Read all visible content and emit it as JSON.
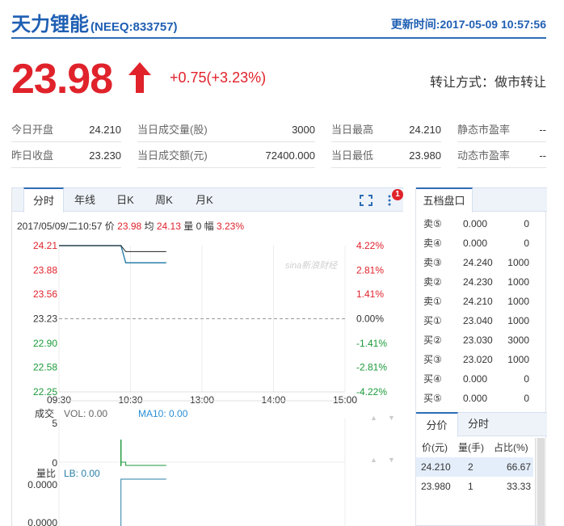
{
  "header": {
    "name": "天力锂能",
    "code": "(NEEQ:833757)",
    "update_time": "更新时间:2017-05-09 10:57:56"
  },
  "quote": {
    "price": "23.98",
    "change": "+0.75(+3.23%)",
    "transfer_mode": "转让方式：做市转让",
    "color_up": "#e0222b"
  },
  "stats": [
    [
      [
        "今日开盘",
        "24.210"
      ],
      [
        "当日成交量(股)",
        "3000"
      ],
      [
        "当日最高",
        "24.210"
      ],
      [
        "静态市盈率",
        "--"
      ]
    ],
    [
      [
        "昨日收盘",
        "23.230"
      ],
      [
        "当日成交额(元)",
        "72400.000"
      ],
      [
        "当日最低",
        "23.980"
      ],
      [
        "动态市盈率",
        "--"
      ]
    ]
  ],
  "chart_tabs": [
    "分时",
    "年线",
    "日K",
    "周K",
    "月K"
  ],
  "badge_count": "1",
  "info": {
    "date": "2017/05/09/二10:57",
    "price_label": "价",
    "price": "23.98",
    "avg_label": "均",
    "avg": "24.13",
    "vol_label": "量",
    "vol": "0",
    "amp_label": "幅",
    "amp": "3.23%"
  },
  "watermark": "sina新浪财经",
  "chart_data": {
    "type": "line",
    "title": "",
    "y_price_ticks": [
      "24.21",
      "23.88",
      "23.56",
      "23.23",
      "22.90",
      "22.58",
      "22.25"
    ],
    "y_pct_ticks": [
      "4.22%",
      "2.81%",
      "1.41%",
      "0.00%",
      "-1.41%",
      "-2.81%",
      "-4.22%"
    ],
    "x_ticks": [
      "09:30",
      "10:30",
      "13:00",
      "14:00",
      "15:00"
    ],
    "prev_close": 23.23,
    "ylim": [
      22.25,
      24.21
    ],
    "series": [
      {
        "name": "价",
        "color": "#2a7fa8",
        "values": [
          [
            0,
            24.21
          ],
          [
            52,
            24.21
          ],
          [
            56,
            23.98
          ],
          [
            90,
            23.98
          ]
        ]
      },
      {
        "name": "均",
        "color": "#222222",
        "values": [
          [
            0,
            24.21
          ],
          [
            52,
            24.21
          ],
          [
            56,
            24.13
          ],
          [
            90,
            24.13
          ]
        ]
      }
    ],
    "volume": {
      "label": "成交",
      "vol_text": "VOL: 0.00",
      "ma_text": "MA10: 0.00",
      "ticks": [
        "5",
        "0"
      ]
    },
    "volume_ratio": {
      "label": "量比",
      "lb_text": "LB: 0.00",
      "ticks": [
        "0.0000",
        "0.0000"
      ]
    }
  },
  "order_book": {
    "title": "五档盘口",
    "rows": [
      [
        "卖⑤",
        "0.000",
        "0"
      ],
      [
        "卖④",
        "0.000",
        "0"
      ],
      [
        "卖③",
        "24.240",
        "1000"
      ],
      [
        "卖②",
        "24.230",
        "1000"
      ],
      [
        "卖①",
        "24.210",
        "1000"
      ],
      [
        "买①",
        "23.040",
        "1000"
      ],
      [
        "买②",
        "23.030",
        "3000"
      ],
      [
        "买③",
        "23.020",
        "1000"
      ],
      [
        "买④",
        "0.000",
        "0"
      ],
      [
        "买⑤",
        "0.000",
        "0"
      ]
    ],
    "tabs": [
      "分价",
      "分时"
    ],
    "headers": [
      "价(元)",
      "量(手)",
      "占比(%)"
    ],
    "price_rows": [
      [
        "24.210",
        "2",
        "66.67"
      ],
      [
        "23.980",
        "1",
        "33.33"
      ]
    ]
  }
}
